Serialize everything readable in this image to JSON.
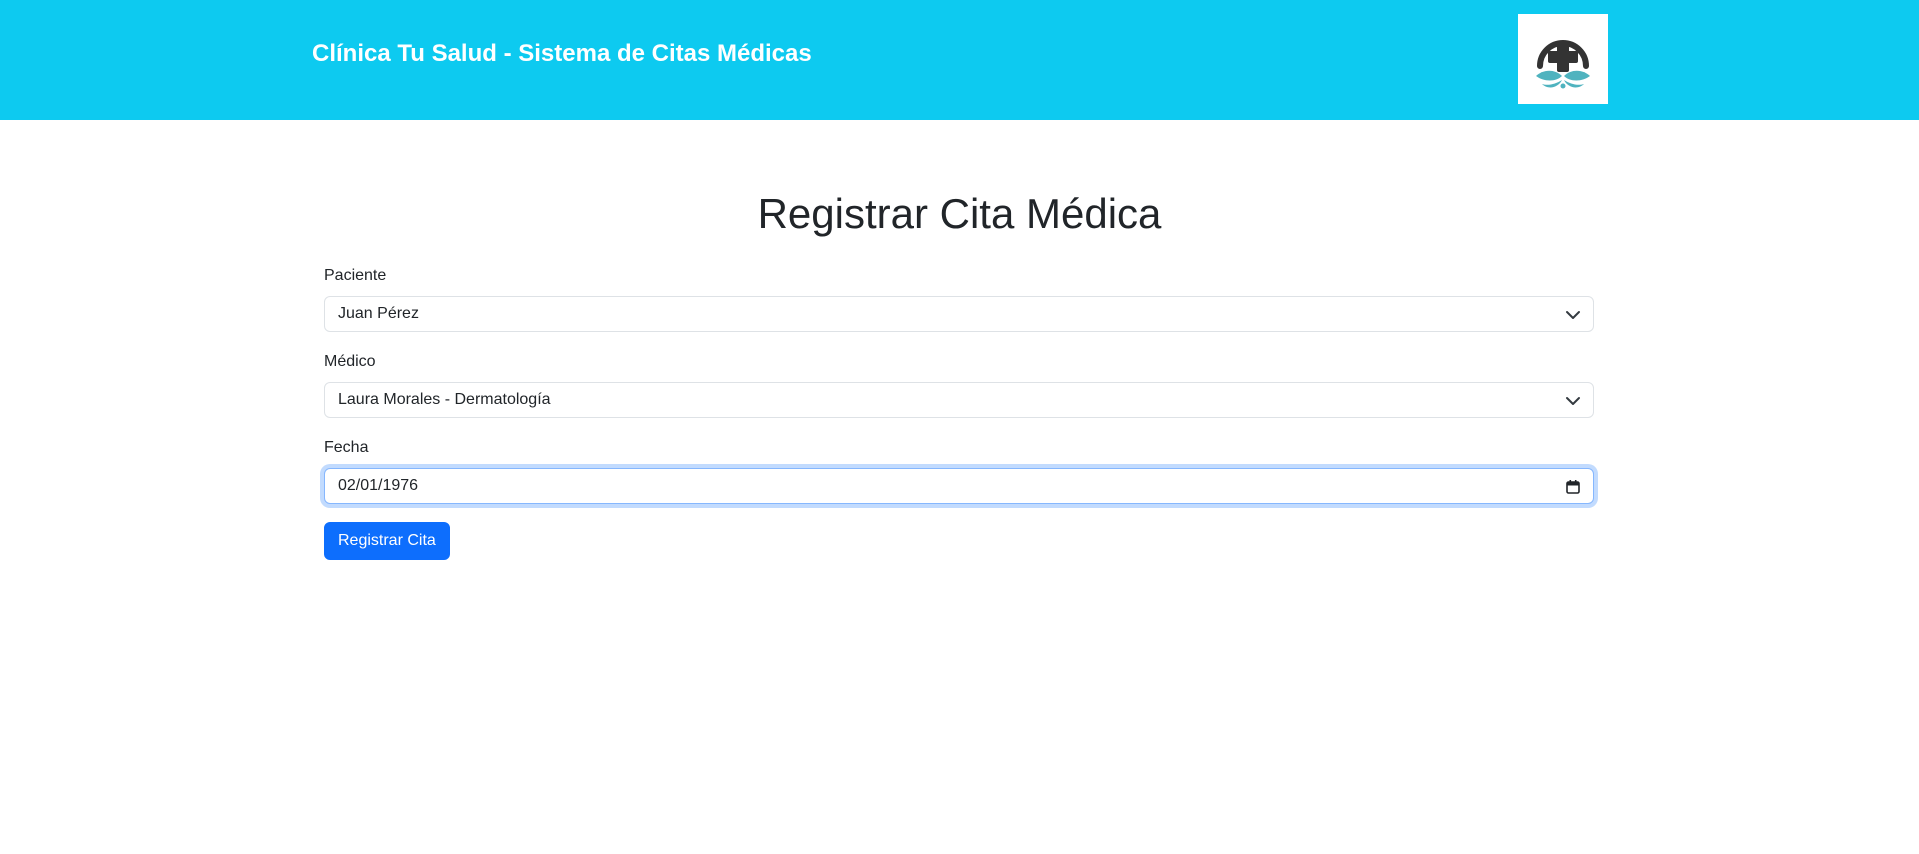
{
  "header": {
    "brand": "Clínica Tu Salud - Sistema de Citas Médicas",
    "logo_icon": "medical-cross-logo-icon",
    "background_color": "#0dcaf0"
  },
  "main": {
    "title": "Registrar Cita Médica",
    "form": {
      "paciente": {
        "label": "Paciente",
        "value": "Juan Pérez"
      },
      "medico": {
        "label": "Médico",
        "value": "Laura Morales - Dermatología"
      },
      "fecha": {
        "label": "Fecha",
        "value": "02/01/1976"
      },
      "submit_label": "Registrar Cita"
    }
  },
  "colors": {
    "accent": "#0d6efd",
    "header": "#0dcaf0",
    "logo_teal": "#4fb3bf",
    "logo_dark": "#333333"
  }
}
